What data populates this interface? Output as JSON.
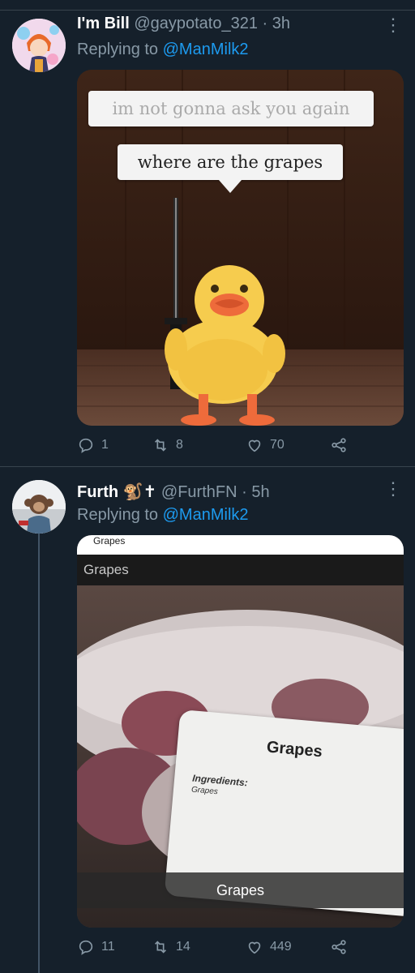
{
  "tweets": [
    {
      "name": "I'm Bill",
      "handle": "@gaypotato_321",
      "time": "3h",
      "replying_prefix": "Replying to",
      "replying_to": "@ManMilk2",
      "meme_text_1": "im not gonna ask you again",
      "meme_text_2": "where are the grapes",
      "replies": "1",
      "retweets": "8",
      "likes": "70"
    },
    {
      "name": "Furth",
      "name_emoji": "🐒✝",
      "handle": "@FurthFN",
      "time": "5h",
      "replying_prefix": "Replying to",
      "replying_to": "@ManMilk2",
      "top_label_small": "Grapes",
      "top_label": "Grapes",
      "card_title": "Grapes",
      "card_ingredients_label": "Ingredients:",
      "card_ingredients": "Grapes",
      "caption": "Grapes",
      "replies": "11",
      "retweets": "14",
      "likes": "449"
    }
  ],
  "colors": {
    "background": "#15202b",
    "accent": "#1d9bf0",
    "muted": "#8899a6",
    "divider": "#38444d"
  },
  "icons": [
    "more-icon",
    "reply-icon",
    "retweet-icon",
    "like-icon",
    "share-icon"
  ]
}
